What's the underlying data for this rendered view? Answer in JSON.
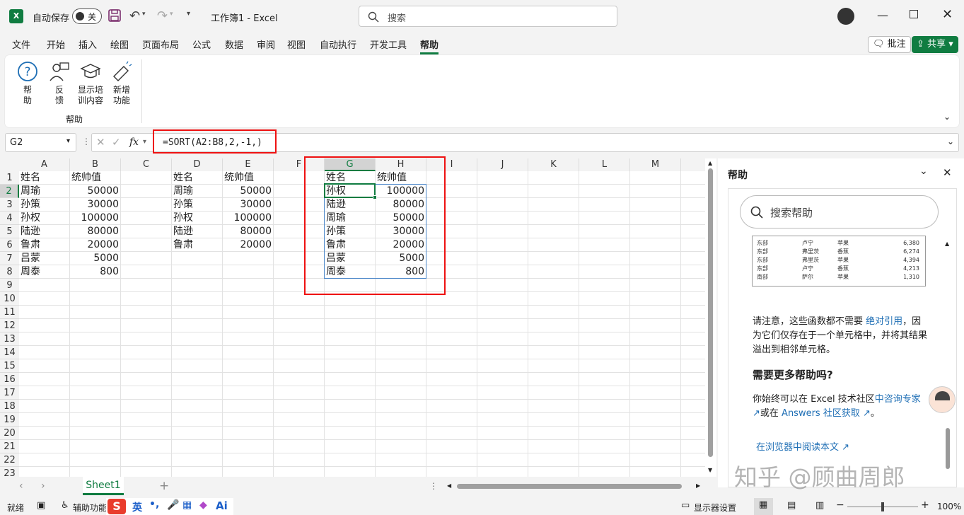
{
  "app": {
    "autosave_label": "自动保存",
    "autosave_state": "关",
    "title": "工作簿1  -  Excel",
    "search_placeholder": "搜索"
  },
  "menu": [
    "文件",
    "开始",
    "插入",
    "绘图",
    "页面布局",
    "公式",
    "数据",
    "审阅",
    "视图",
    "自动执行",
    "开发工具",
    "帮助"
  ],
  "menu_active": "帮助",
  "menu_right": {
    "comment": "批注",
    "share": "共享"
  },
  "ribbon": {
    "group_label": "帮助",
    "buttons": [
      {
        "line1": "帮",
        "line2": "助"
      },
      {
        "line1": "反",
        "line2": "馈"
      },
      {
        "line1": "显示培",
        "line2": "训内容"
      },
      {
        "line1": "新增",
        "line2": "功能"
      }
    ]
  },
  "formula": {
    "namebox": "G2",
    "fx": "fx",
    "value": "=SORT(A2:B8,2,-1,)"
  },
  "grid": {
    "columns": [
      "A",
      "B",
      "C",
      "D",
      "E",
      "F",
      "G",
      "H",
      "I",
      "J",
      "K",
      "L",
      "M"
    ],
    "rows": [
      "1",
      "2",
      "3",
      "4",
      "5",
      "6",
      "7",
      "8",
      "9",
      "10",
      "11",
      "12",
      "13",
      "14",
      "15",
      "16",
      "17",
      "18",
      "19",
      "20",
      "21",
      "22",
      "23"
    ],
    "tableA": [
      [
        "姓名",
        "统帅值"
      ],
      [
        "周瑜",
        "50000"
      ],
      [
        "孙策",
        "30000"
      ],
      [
        "孙权",
        "100000"
      ],
      [
        "陆逊",
        "80000"
      ],
      [
        "鲁肃",
        "20000"
      ],
      [
        "吕蒙",
        "5000"
      ],
      [
        "周泰",
        "800"
      ]
    ],
    "tableD": [
      [
        "姓名",
        "统帅值"
      ],
      [
        "周瑜",
        "50000"
      ],
      [
        "孙策",
        "30000"
      ],
      [
        "孙权",
        "100000"
      ],
      [
        "陆逊",
        "80000"
      ],
      [
        "鲁肃",
        "20000"
      ]
    ],
    "tableG": [
      [
        "姓名",
        "统帅值"
      ],
      [
        "孙权",
        "100000"
      ],
      [
        "陆逊",
        "80000"
      ],
      [
        "周瑜",
        "50000"
      ],
      [
        "孙策",
        "30000"
      ],
      [
        "鲁肃",
        "20000"
      ],
      [
        "吕蒙",
        "5000"
      ],
      [
        "周泰",
        "800"
      ]
    ]
  },
  "sheet_tab": "Sheet1",
  "pane": {
    "title": "帮助",
    "search_placeholder": "搜索帮助",
    "mini_table": [
      [
        "东部",
        "卢宁",
        "苹果",
        "6,380"
      ],
      [
        "东部",
        "弗里茨",
        "香蕉",
        "6,274"
      ],
      [
        "东部",
        "弗里茨",
        "苹果",
        "4,394"
      ],
      [
        "东部",
        "卢宁",
        "香蕉",
        "4,213"
      ],
      [
        "南部",
        "萨尔",
        "苹果",
        "1,310"
      ]
    ],
    "para1_a": "请注意，这些函数都不需要 ",
    "para1_link": "绝对引用",
    "para1_b": "，因为它们仅存在于一个单元格中，并将其结果溢出到相邻单元格。",
    "heading": "需要更多帮助吗?",
    "para2_a": "你始终可以在 Excel 技术社区",
    "para2_link1": "中咨询专家",
    "para2_b": "或在 ",
    "para2_link2": "Answers 社区获取",
    "para2_c": "。",
    "browser_link": "在浏览器中阅读本文"
  },
  "watermark": "知乎 @顾曲周郎",
  "status": {
    "ready": "就绪",
    "accessibility": "辅助功能",
    "ime": "英",
    "display_settings": "显示器设置",
    "zoom": "100%"
  }
}
